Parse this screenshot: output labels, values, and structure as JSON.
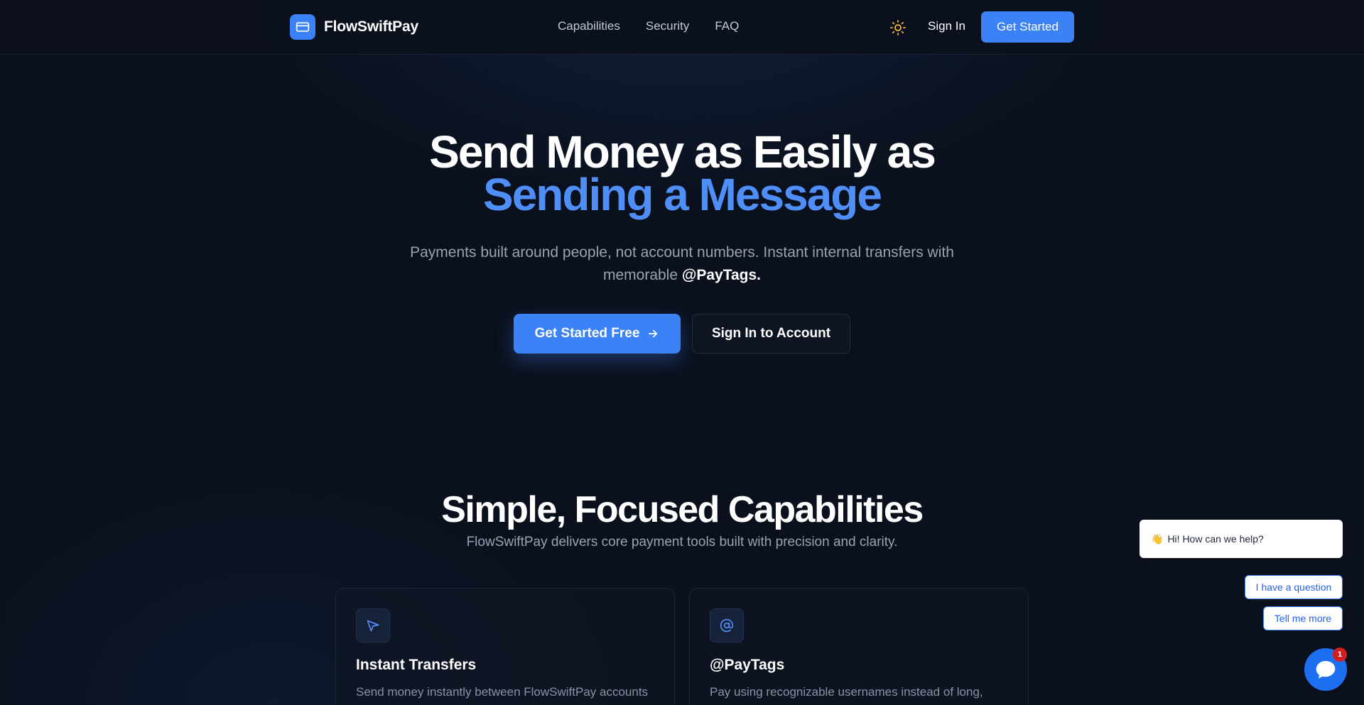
{
  "brand": {
    "name": "FlowSwiftPay",
    "logo_icon": "credit-card-icon",
    "accent": "#3b82f6"
  },
  "nav": {
    "links": [
      "Capabilities",
      "Security",
      "FAQ"
    ],
    "theme_icon": "sun-icon",
    "signin_label": "Sign In",
    "cta_label": "Get Started"
  },
  "hero": {
    "title_line1": "Send Money as Easily as",
    "title_line2": "Sending a Message",
    "title_line2_color": "#4f8ef7",
    "subtitle_text": "Payments built around people, not account numbers. Instant internal transfers with memorable",
    "subtitle_highlight": "@PayTags.",
    "primary_label": "Get Started Free",
    "primary_icon": "arrow-right-icon",
    "secondary_label": "Sign In to Account"
  },
  "capabilities": {
    "title": "Simple, Focused Capabilities",
    "subtitle": "FlowSwiftPay delivers core payment tools built with precision and clarity.",
    "cards": [
      {
        "icon": "send-icon",
        "title": "Instant Transfers",
        "description": "Send money instantly between FlowSwiftPay accounts with zero processing delays."
      },
      {
        "icon": "at-sign-icon",
        "title": "@PayTags",
        "description": "Pay using recognizable usernames instead of long, confusing account numbers."
      }
    ]
  },
  "chat": {
    "greeting": "Hi! How can we help?",
    "greeting_emoji": "👋",
    "options": [
      "I have a question",
      "Tell me more"
    ],
    "launcher_icon": "chat-icon",
    "unread_count": "1"
  }
}
